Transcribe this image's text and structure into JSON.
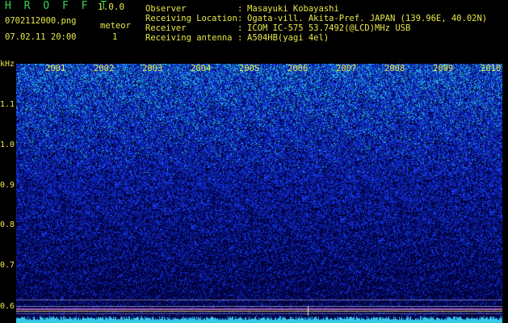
{
  "header": {
    "app_name": "H R O F F T",
    "version": "1.0.0",
    "filename": "0702112000.png",
    "datetime": "07.02.11 20:00",
    "meteor_label": "meteor",
    "meteor_count": "1"
  },
  "info": {
    "observer_label": "Observer",
    "observer_value": "Masayuki Kobayashi",
    "location_label": "Receiving Location",
    "location_value": "Ogata-vill. Akita-Pref. JAPAN (139.96E, 40.02N)",
    "receiver_label": "Receiver",
    "receiver_value": "ICOM IC-575 53.7492(@LCD)MHz USB",
    "antenna_label": "Receiving antenna",
    "antenna_value": "A504HB(yagi 4el)",
    "colon": ":"
  },
  "axis": {
    "unit": "kHz",
    "y_labels": [
      "1.1",
      "1.0",
      "0.9",
      "0.8",
      "0.7",
      "0.6"
    ],
    "x_labels": [
      "2001",
      "2002",
      "2003",
      "2004",
      "2005",
      "2006",
      "2007",
      "2008",
      "2009",
      "2010"
    ]
  },
  "colors": {
    "label_yellow": "#e8e84a",
    "title_green": "#39d353",
    "noise_blue": "#1a3cff",
    "noise_cyan": "#38e0e0"
  }
}
